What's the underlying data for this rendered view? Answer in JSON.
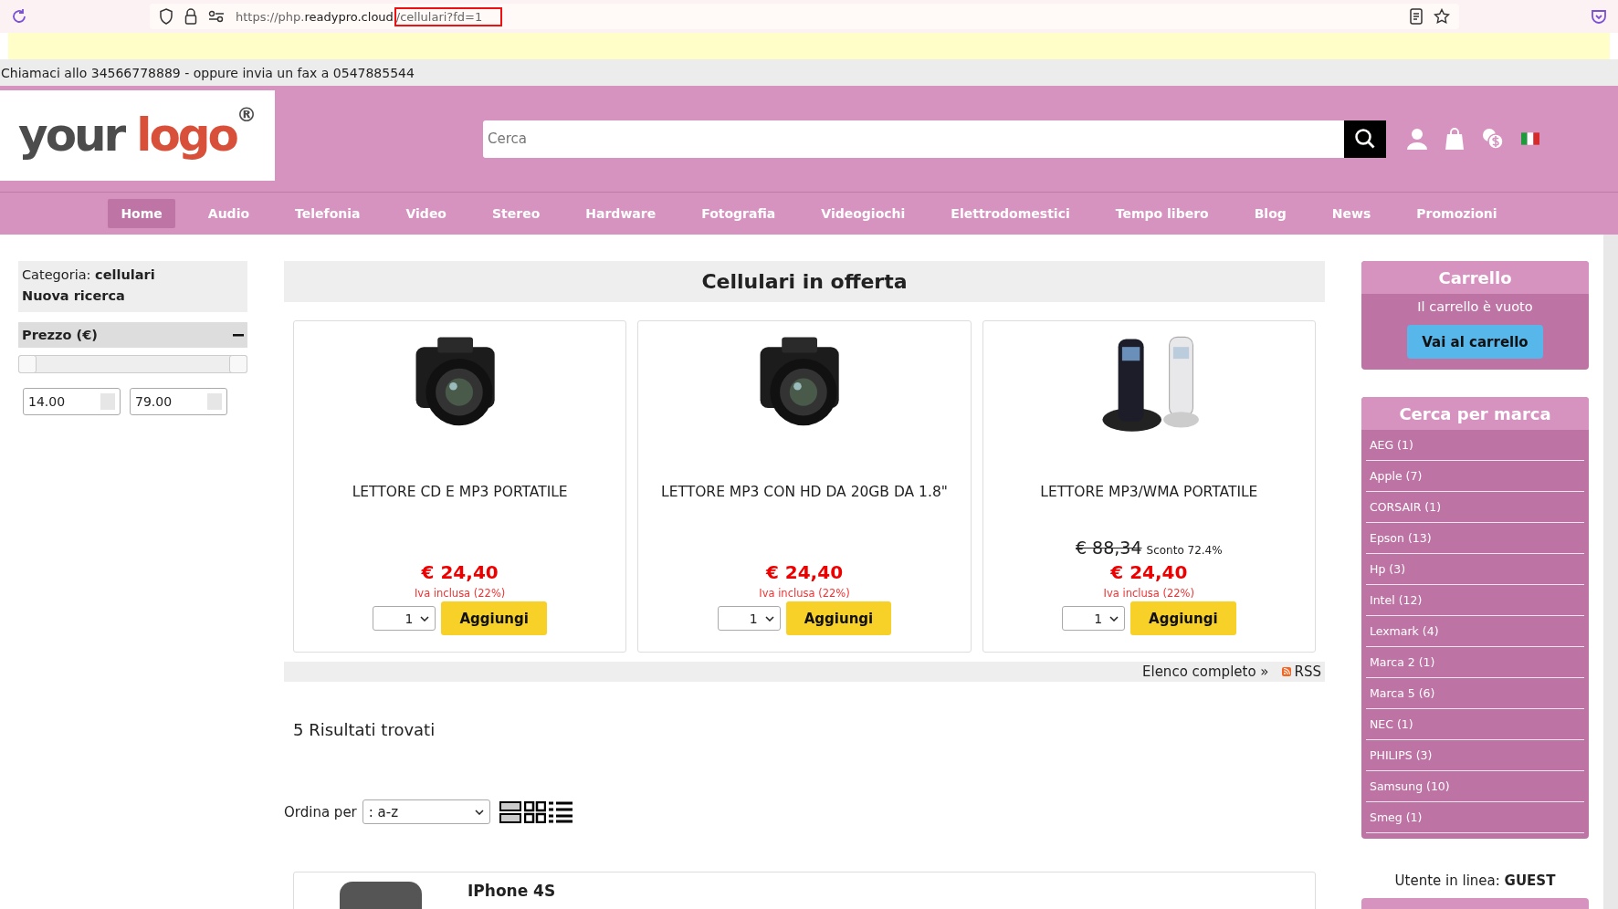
{
  "browser": {
    "url_scheme": "https://php.",
    "url_domain": "readypro.cloud",
    "url_path": "/cellulari?fd=1"
  },
  "contact_bar": "Chiamaci allo 34566778889 - oppure invia un fax a 0547885544",
  "header": {
    "logo": {
      "word_1": "your",
      "word_2": "logo",
      "mark": "®"
    },
    "search": {
      "placeholder": "Cerca"
    }
  },
  "nav": [
    {
      "label": "Home",
      "selected": true
    },
    {
      "label": "Audio",
      "selected": false
    },
    {
      "label": "Telefonia",
      "selected": false
    },
    {
      "label": "Video",
      "selected": false
    },
    {
      "label": "Stereo",
      "selected": false
    },
    {
      "label": "Hardware",
      "selected": false
    },
    {
      "label": "Fotografia",
      "selected": false
    },
    {
      "label": "Videogiochi",
      "selected": false
    },
    {
      "label": "Elettrodomestici",
      "selected": false
    },
    {
      "label": "Tempo libero",
      "selected": false
    },
    {
      "label": "Blog",
      "selected": false
    },
    {
      "label": "News",
      "selected": false
    },
    {
      "label": "Promozioni",
      "selected": false
    }
  ],
  "filters": {
    "category_label": "Categoria:",
    "category_value": "cellulari",
    "new_search": "Nuova ricerca",
    "price_title": "Prezzo (€)",
    "price_slider": {
      "level": 1
    },
    "price_min": "14.00",
    "price_max": "79.00"
  },
  "offers": {
    "title": "Cellulari in offerta",
    "products": [
      {
        "kind": "camera",
        "name": "LETTORE CD E MP3 PORTATILE",
        "price": "€ 24,40",
        "vat": "Iva inclusa (22%)",
        "quantity": "1",
        "button": "Aggiungi"
      },
      {
        "kind": "camera",
        "name": "LETTORE MP3 CON HD DA 20GB DA 1.8\"",
        "price": "€ 24,40",
        "vat": "Iva inclusa (22%)",
        "quantity": "1",
        "button": "Aggiungi"
      },
      {
        "kind": "phone",
        "name": "LETTORE MP3/WMA PORTATILE",
        "old_price": "€ 88,34",
        "discount": "Sconto 72.4%",
        "price": "€ 24,40",
        "vat": "Iva inclusa (22%)",
        "quantity": "1",
        "button": "Aggiungi"
      }
    ],
    "full_list_link": "Elenco completo »",
    "rss_link": "RSS"
  },
  "results": {
    "count": "5 Risultati trovati",
    "sort_label": "Ordina per",
    "sort_value": ": a-z",
    "items": [
      {
        "name": "IPhone 4S"
      }
    ]
  },
  "cart": {
    "title": "Carrello",
    "status": "Il carrello è vuoto",
    "button": "Vai al carrello"
  },
  "brands": {
    "title": "Cerca per marca",
    "items": [
      "AEG (1)",
      "Apple (7)",
      "CORSAIR (1)",
      "Epson (13)",
      "Hp (3)",
      "Intel (12)",
      "Lexmark (4)",
      "Marca 2 (1)",
      "Marca 5 (6)",
      "NEC (1)",
      "PHILIPS (3)",
      "Samsung (10)",
      "Smeg (1)"
    ]
  },
  "user_online": {
    "label": "Utente in linea:",
    "value": "GUEST"
  }
}
